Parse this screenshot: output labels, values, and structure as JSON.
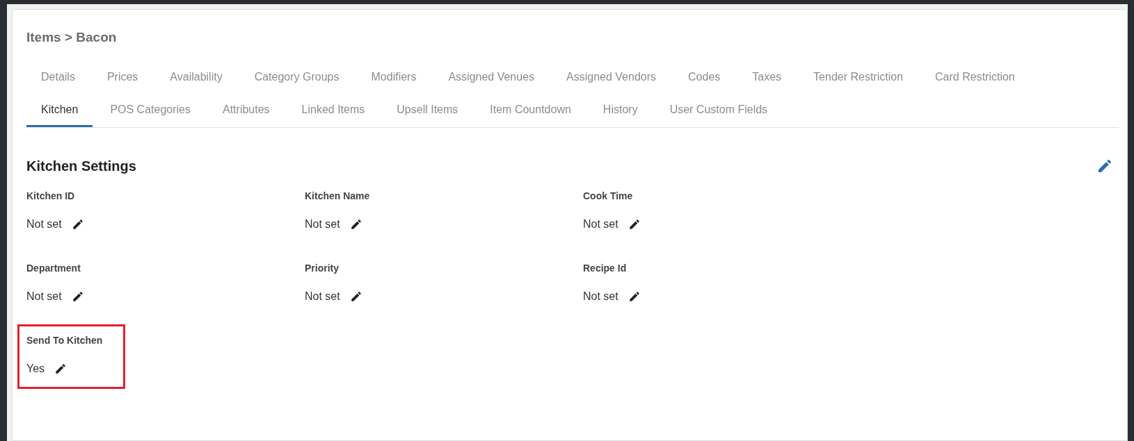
{
  "breadcrumb": "Items > Bacon",
  "tabs": [
    {
      "label": "Details",
      "selected": false
    },
    {
      "label": "Prices",
      "selected": false
    },
    {
      "label": "Availability",
      "selected": false
    },
    {
      "label": "Category Groups",
      "selected": false
    },
    {
      "label": "Modifiers",
      "selected": false
    },
    {
      "label": "Assigned Venues",
      "selected": false
    },
    {
      "label": "Assigned Vendors",
      "selected": false
    },
    {
      "label": "Codes",
      "selected": false
    },
    {
      "label": "Taxes",
      "selected": false
    },
    {
      "label": "Tender Restriction",
      "selected": false
    },
    {
      "label": "Card Restriction",
      "selected": false
    },
    {
      "label": "Kitchen",
      "selected": true
    },
    {
      "label": "POS Categories",
      "selected": false
    },
    {
      "label": "Attributes",
      "selected": false
    },
    {
      "label": "Linked Items",
      "selected": false
    },
    {
      "label": "Upsell Items",
      "selected": false
    },
    {
      "label": "Item Countdown",
      "selected": false
    },
    {
      "label": "History",
      "selected": false
    },
    {
      "label": "User Custom Fields",
      "selected": false
    }
  ],
  "section": {
    "title": "Kitchen Settings",
    "fields": [
      {
        "label": "Kitchen ID",
        "value": "Not set",
        "highlighted": false
      },
      {
        "label": "Kitchen Name",
        "value": "Not set",
        "highlighted": false
      },
      {
        "label": "Cook Time",
        "value": "Not set",
        "highlighted": false
      },
      {
        "label": "Department",
        "value": "Not set",
        "highlighted": false
      },
      {
        "label": "Priority",
        "value": "Not set",
        "highlighted": false
      },
      {
        "label": "Recipe Id",
        "value": "Not set",
        "highlighted": false
      },
      {
        "label": "Send To Kitchen",
        "value": "Yes",
        "highlighted": true
      }
    ]
  }
}
